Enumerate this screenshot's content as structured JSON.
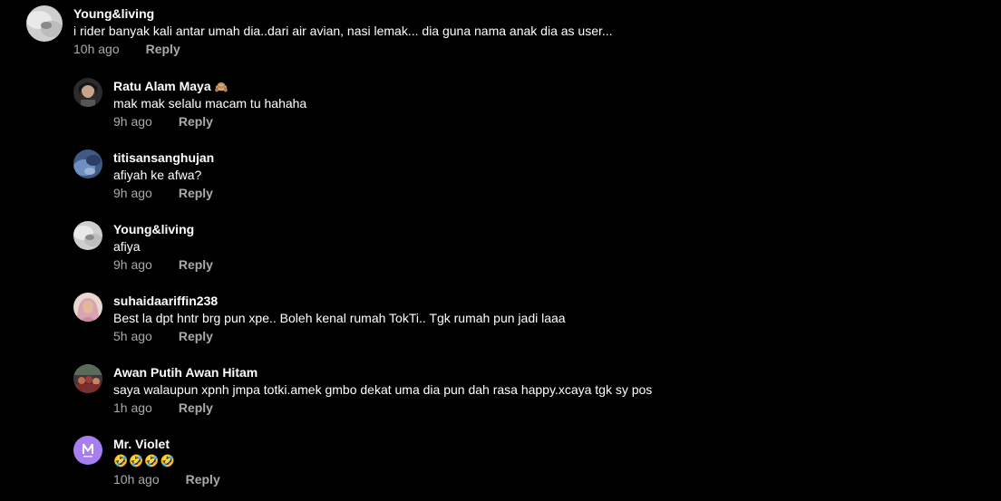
{
  "top_comment": {
    "username": "Young&living",
    "text": "i rider banyak kali antar umah dia..dari air avian, nasi lemak... dia guna nama anak dia as user...",
    "time": "10h ago",
    "reply_label": "Reply"
  },
  "replies": [
    {
      "username": "Ratu Alam Maya",
      "badge": "🙈",
      "text": "mak mak selalu macam tu hahaha",
      "time": "9h ago",
      "reply_label": "Reply"
    },
    {
      "username": "titisansanghujan",
      "text": "afiyah ke afwa?",
      "time": "9h ago",
      "reply_label": "Reply"
    },
    {
      "username": "Young&living",
      "text": "afiya",
      "time": "9h ago",
      "reply_label": "Reply"
    },
    {
      "username": "suhaidaariffin238",
      "text": "Best la dpt hntr brg pun xpe.. Boleh kenal rumah TokTi.. Tgk rumah pun jadi laaa",
      "time": "5h ago",
      "reply_label": "Reply"
    },
    {
      "username": "Awan Putih Awan Hitam",
      "text": "saya walaupun xpnh jmpa totki.amek gmbo dekat uma dia pun dah rasa happy.xcaya tgk sy pos",
      "time": "1h ago",
      "reply_label": "Reply"
    },
    {
      "username": "Mr. Violet",
      "text": "🤣🤣🤣🤣",
      "time": "10h ago",
      "reply_label": "Reply"
    }
  ],
  "colors": {
    "background": "#000000",
    "text": "#ffffff",
    "muted": "#aaaaaa"
  },
  "avatars": [
    "grey-white-photo-avatar",
    "woman-photo-avatar",
    "blue-photo-avatar",
    "grey-white-photo-avatar",
    "hijab-woman-avatar",
    "group-photo-avatar",
    "purple-logo-avatar"
  ]
}
